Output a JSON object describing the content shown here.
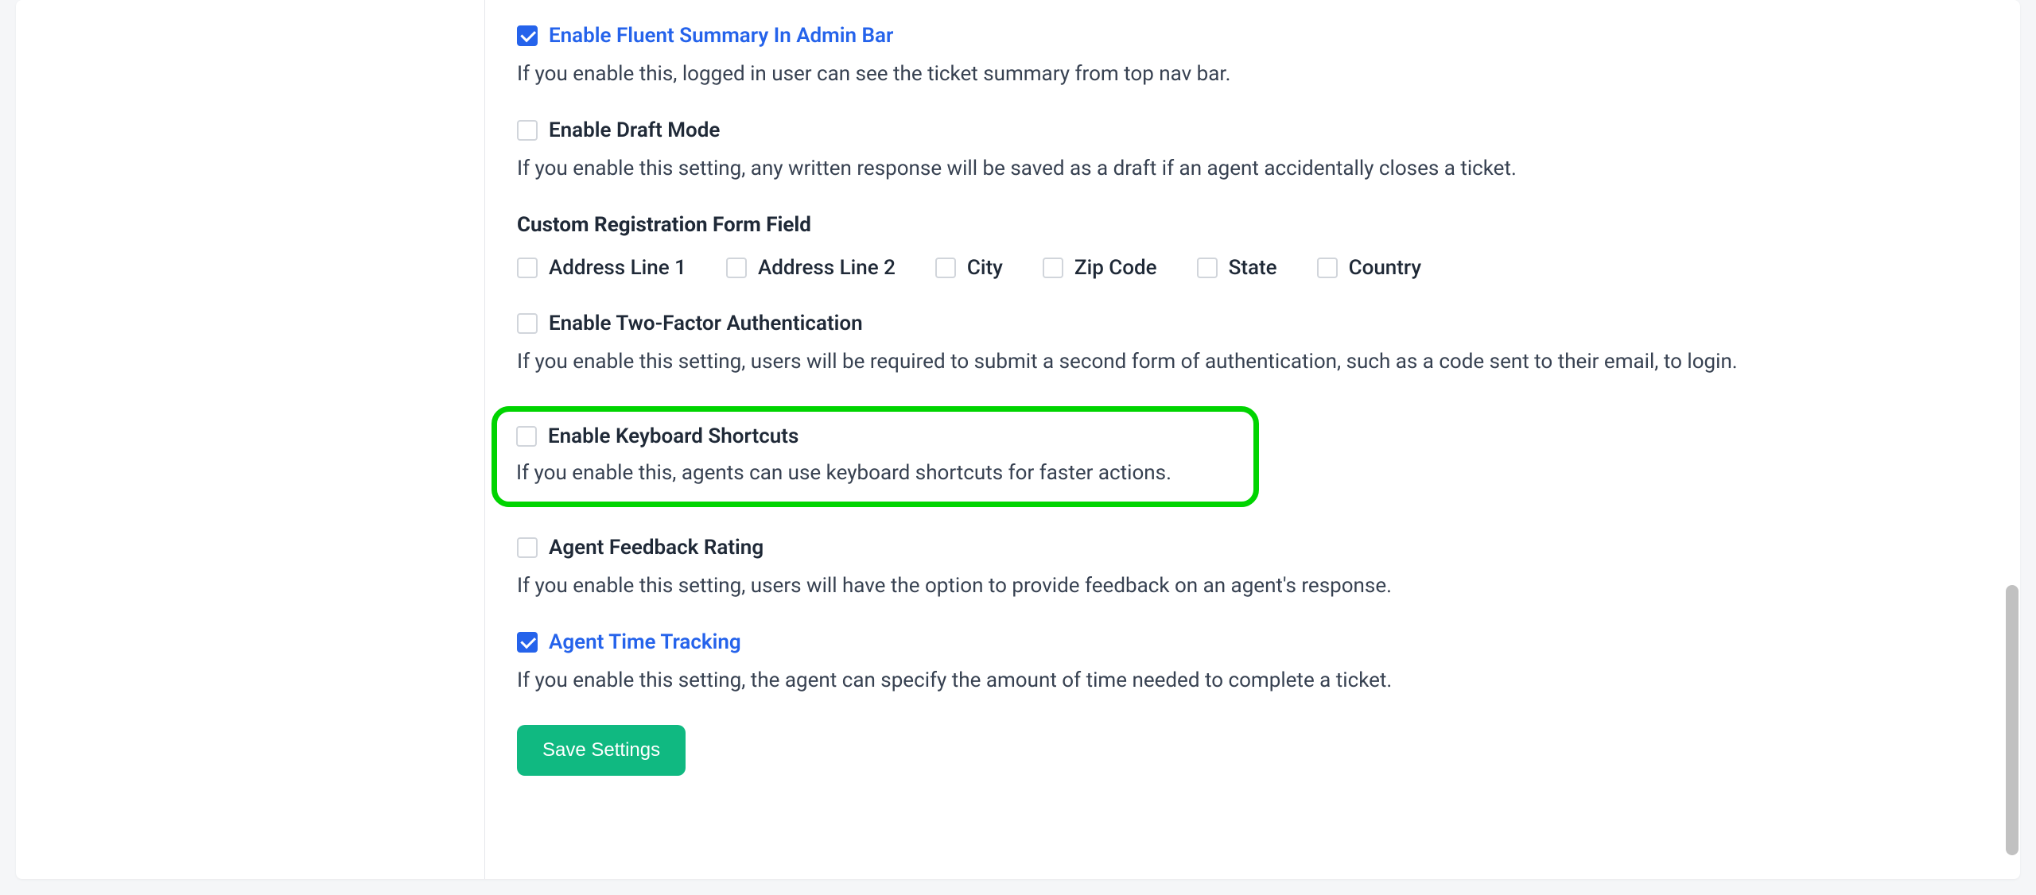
{
  "settings": {
    "fluentSummary": {
      "label": "Enable Fluent Summary In Admin Bar",
      "description": "If you enable this, logged in user can see the ticket summary from top nav bar.",
      "checked": true
    },
    "draftMode": {
      "label": "Enable Draft Mode",
      "description": "If you enable this setting, any written response will be saved as a draft if an agent accidentally closes a ticket.",
      "checked": false
    },
    "customRegistration": {
      "heading": "Custom Registration Form Field",
      "fields": {
        "addressLine1": {
          "label": "Address Line 1",
          "checked": false
        },
        "addressLine2": {
          "label": "Address Line 2",
          "checked": false
        },
        "city": {
          "label": "City",
          "checked": false
        },
        "zipCode": {
          "label": "Zip Code",
          "checked": false
        },
        "state": {
          "label": "State",
          "checked": false
        },
        "country": {
          "label": "Country",
          "checked": false
        }
      }
    },
    "twoFactor": {
      "label": "Enable Two-Factor Authentication",
      "description": "If you enable this setting, users will be required to submit a second form of authentication, such as a code sent to their email, to login.",
      "checked": false
    },
    "keyboardShortcuts": {
      "label": "Enable Keyboard Shortcuts",
      "description": "If you enable this, agents can use keyboard shortcuts for faster actions.",
      "checked": false
    },
    "agentFeedback": {
      "label": "Agent Feedback Rating",
      "description": "If you enable this setting, users will have the option to provide feedback on an agent's response.",
      "checked": false
    },
    "agentTimeTracking": {
      "label": "Agent Time Tracking",
      "description": "If you enable this setting, the agent can specify the amount of time needed to complete a ticket.",
      "checked": true
    }
  },
  "buttons": {
    "save": "Save Settings"
  }
}
